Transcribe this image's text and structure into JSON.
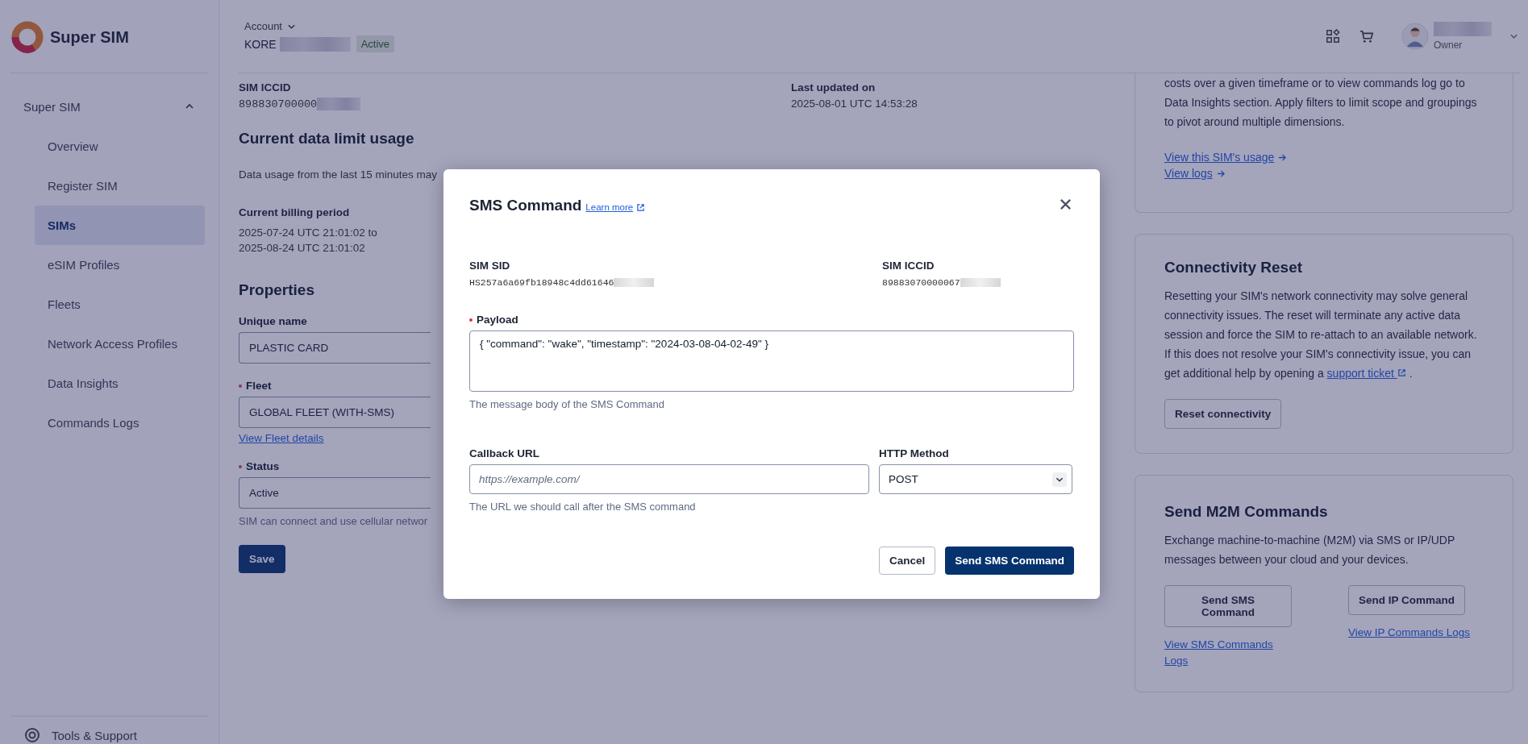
{
  "sidebar": {
    "brand": "Super SIM",
    "section": {
      "label": "Super SIM",
      "expanded": true
    },
    "items": [
      {
        "label": "Overview",
        "selected": false
      },
      {
        "label": "Register SIM",
        "selected": false
      },
      {
        "label": "SIMs",
        "selected": true
      },
      {
        "label": "eSIM Profiles",
        "selected": false
      },
      {
        "label": "Fleets",
        "selected": false
      },
      {
        "label": "Network Access Profiles",
        "selected": false
      },
      {
        "label": "Data Insights",
        "selected": false
      },
      {
        "label": "Commands Logs",
        "selected": false
      }
    ],
    "footer": "Tools & Support"
  },
  "header": {
    "account_label": "Account",
    "account_name": "KORE",
    "account_status": "Active",
    "user_role": "Owner"
  },
  "details": [
    {
      "label": "SIM ICCID",
      "value": "898830700000",
      "kind": "mono"
    },
    {
      "label": "Last updated on",
      "value": "2025-08-01 UTC 14:53:28",
      "kind": "plain"
    }
  ],
  "usage": {
    "title": "Current data limit usage",
    "note": "Data usage from the last 15 minutes may",
    "billing_label": "Current billing period",
    "billing_lines": [
      "2025-07-24 UTC 21:01:02 to",
      "2025-08-24 UTC 21:01:02"
    ]
  },
  "properties": {
    "title": "Properties",
    "fields": [
      {
        "label": "Unique name",
        "value": "PLASTIC CARD"
      },
      {
        "label": "Fleet",
        "value": "GLOBAL FLEET (WITH-SMS)",
        "required": true,
        "link": "View Fleet details"
      },
      {
        "label": "Status",
        "value": "Active",
        "required": true,
        "help": "SIM can connect and use cellular networ"
      }
    ],
    "save": "Save"
  },
  "cards": [
    {
      "kind": "insights",
      "text": "costs over a given timeframe or to view commands log go to Data Insights section. Apply filters to limit scope and groupings to pivot around multiple dimensions.",
      "links": [
        "View this SIM's usage",
        "View logs"
      ]
    },
    {
      "kind": "reset",
      "title": "Connectivity Reset",
      "text": "Resetting your SIM's network connectivity may solve general connectivity issues. The reset will terminate any active data session and force the SIM to re-attach to an available network. If this does not resolve your SIM's connectivity issue, you can get additional help by opening a",
      "link": "support ticket",
      "after": ".",
      "button": "Reset connectivity"
    },
    {
      "kind": "m2m",
      "title": "Send M2M Commands",
      "text": "Exchange machine-to-machine (M2M) via SMS or IP/UDP messages between your cloud and your devices.",
      "actions": [
        {
          "button": "Send SMS Command",
          "link": "View SMS Commands Logs"
        },
        {
          "button": "Send IP Command",
          "link": "View IP Commands Logs"
        }
      ]
    }
  ],
  "modal": {
    "title": "SMS Command",
    "learn_more": "Learn more",
    "ids": [
      {
        "label": "SIM SID",
        "value": "HS257a6a69fb18948c4dd61646"
      },
      {
        "label": "SIM ICCID",
        "value": "89883070000067"
      }
    ],
    "payload": {
      "label": "Payload",
      "required": true,
      "value": "{ \"command\": \"wake\", \"timestamp\": \"2024-03-08-04-02-49\" }",
      "help": "The message body of the SMS Command"
    },
    "callback": {
      "label": "Callback URL",
      "placeholder": "https://example.com/",
      "help": "The URL we should call after the SMS command"
    },
    "method": {
      "label": "HTTP Method",
      "value": "POST"
    },
    "cancel": "Cancel",
    "submit": "Send SMS Command"
  }
}
